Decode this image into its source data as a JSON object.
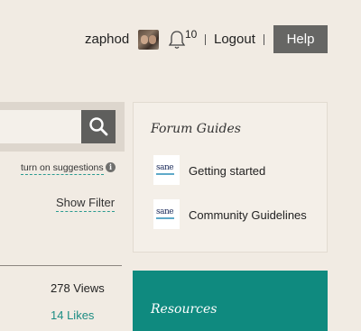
{
  "header": {
    "username": "zaphod",
    "notification_count": "10",
    "logout_label": "Logout",
    "help_label": "Help"
  },
  "search": {
    "value": "",
    "suggestions_label": "turn on suggestions",
    "show_filter_label": "Show Filter"
  },
  "stats": {
    "views": "278 Views",
    "likes": "14 Likes"
  },
  "forum_guides": {
    "title": "Forum Guides",
    "items": [
      {
        "label": "Getting started",
        "logo_text": "sane"
      },
      {
        "label": "Community Guidelines",
        "logo_text": "sane"
      }
    ]
  },
  "resources": {
    "title": "Resources"
  },
  "colors": {
    "accent": "#0f8a7f",
    "background": "#f1ebe3",
    "button": "#666664"
  }
}
